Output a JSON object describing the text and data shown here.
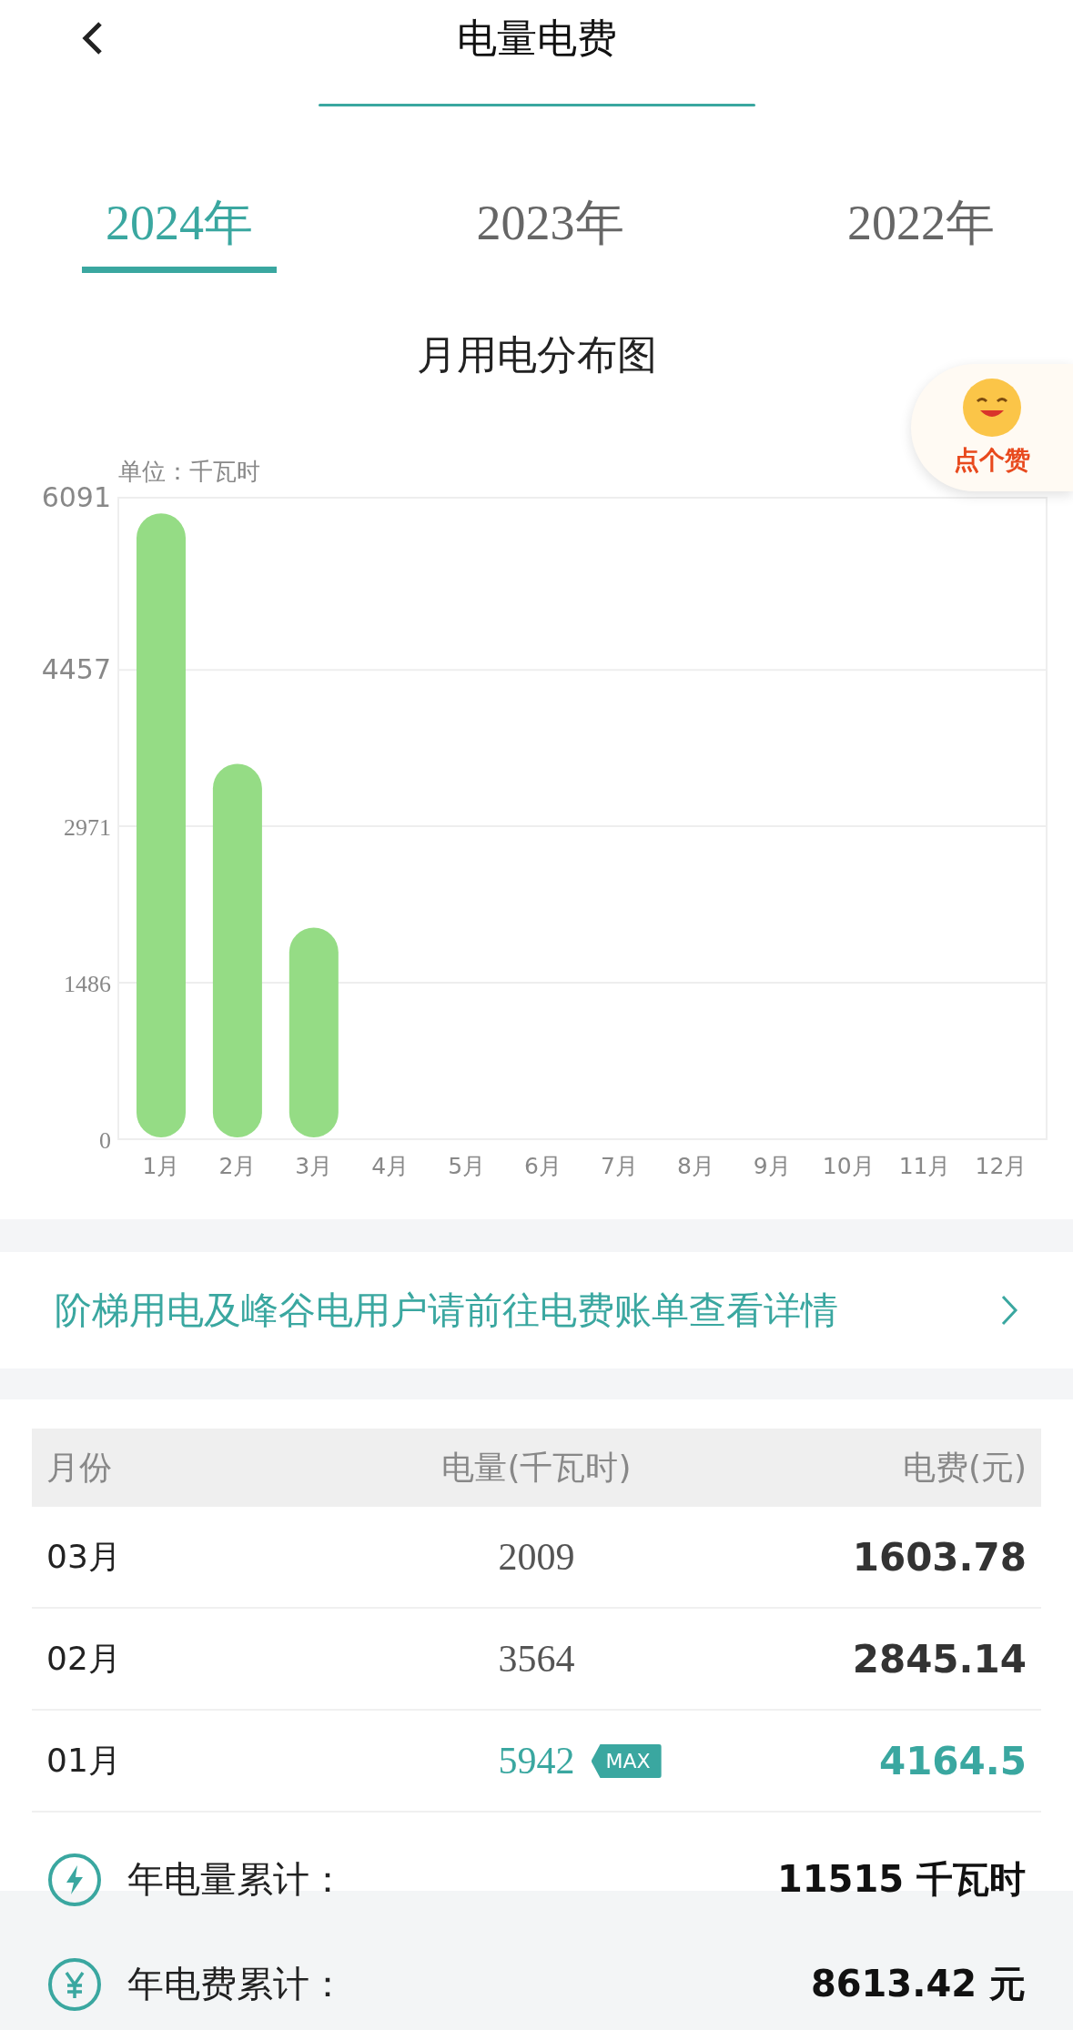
{
  "header": {
    "title": "电量电费"
  },
  "tabs": [
    {
      "label": "2024年",
      "selected": true
    },
    {
      "label": "2023年",
      "selected": false
    },
    {
      "label": "2022年",
      "selected": false
    }
  ],
  "chart": {
    "title": "月用电分布图",
    "chart_data": {
      "type": "bar",
      "ylabel": "单位：千瓦时",
      "categories": [
        "1月",
        "2月",
        "3月",
        "4月",
        "5月",
        "6月",
        "7月",
        "8月",
        "9月",
        "10月",
        "11月",
        "12月"
      ],
      "values": [
        5942,
        3564,
        2009,
        null,
        null,
        null,
        null,
        null,
        null,
        null,
        null,
        null
      ],
      "ylim": [
        0,
        6091
      ],
      "grid": true,
      "yticks": [
        0,
        1486,
        2971,
        4457,
        6091
      ]
    }
  },
  "like_badge": {
    "label": "点个赞"
  },
  "notice": {
    "text": "阶梯用电及峰谷电用户请前往电费账单查看详情"
  },
  "table": {
    "columns": [
      "月份",
      "电量(千瓦时)",
      "电费(元)"
    ],
    "rows": [
      {
        "month": "03月",
        "energy": "2009",
        "fee": "1603.78",
        "highlighted": false
      },
      {
        "month": "02月",
        "energy": "3564",
        "fee": "2845.14",
        "highlighted": false
      },
      {
        "month": "01月",
        "energy": "5942",
        "fee": "4164.5",
        "highlighted": true,
        "badge": "MAX"
      }
    ]
  },
  "summary": [
    {
      "kind": "energy",
      "label": "年电量累计：",
      "value": "11515 千瓦时"
    },
    {
      "kind": "money",
      "label": "年电费累计：",
      "value": "8613.42 元"
    }
  ]
}
